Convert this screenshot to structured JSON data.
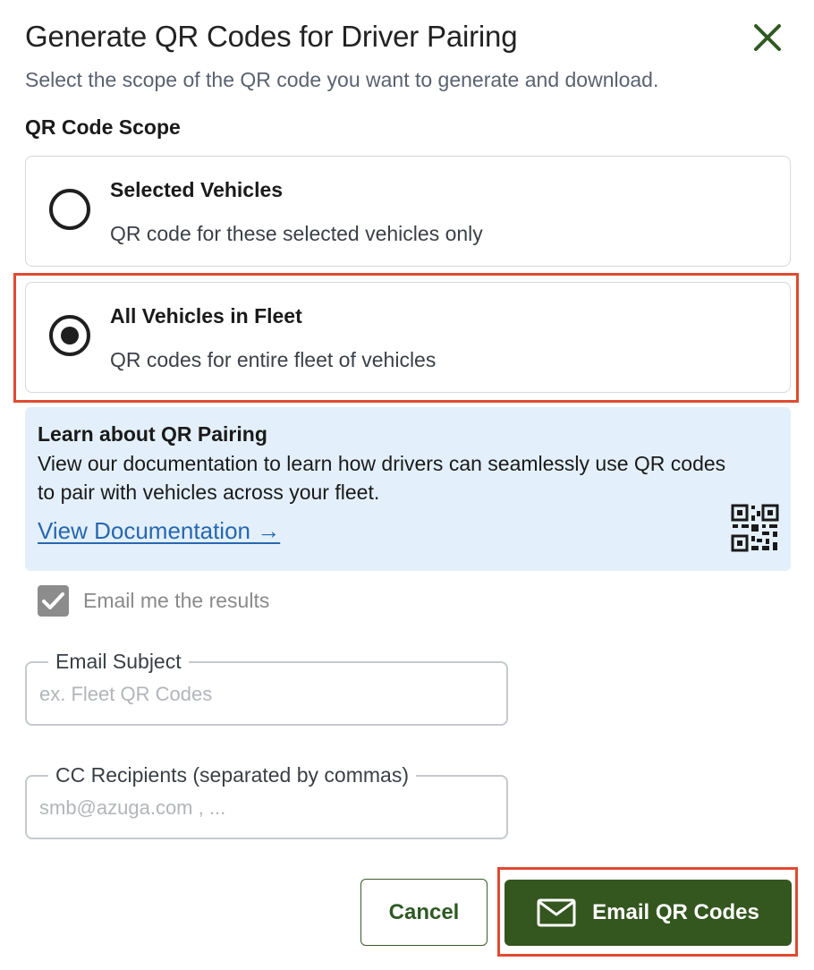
{
  "dialog": {
    "title": "Generate QR Codes for Driver Pairing",
    "subtitle": "Select the scope of the QR code you want to generate and download.",
    "close_icon": "close-icon",
    "accent_color": "#34561f"
  },
  "scope": {
    "label": "QR Code Scope",
    "options": [
      {
        "title": "Selected Vehicles",
        "description": "QR code for these selected vehicles only",
        "selected": false
      },
      {
        "title": "All Vehicles in Fleet",
        "description": "QR codes for entire fleet of vehicles",
        "selected": true
      }
    ]
  },
  "info": {
    "title": "Learn about QR Pairing",
    "text": "View our documentation to learn how drivers can seamlessly use QR codes to pair with vehicles across your fleet.",
    "link_label": "View Documentation →",
    "icon": "qr-code-icon",
    "background": "#e3f0fb"
  },
  "email_results": {
    "label": "Email me the results",
    "checked": true
  },
  "fields": {
    "subject": {
      "label": "Email Subject",
      "placeholder": "ex. Fleet QR Codes",
      "value": ""
    },
    "cc": {
      "label": "CC Recipients (separated by commas)",
      "placeholder": "smb@azuga.com , ...",
      "value": ""
    }
  },
  "actions": {
    "cancel_label": "Cancel",
    "email_label": "Email QR Codes",
    "email_icon": "mail-icon"
  },
  "highlight_color": "#e04a32"
}
